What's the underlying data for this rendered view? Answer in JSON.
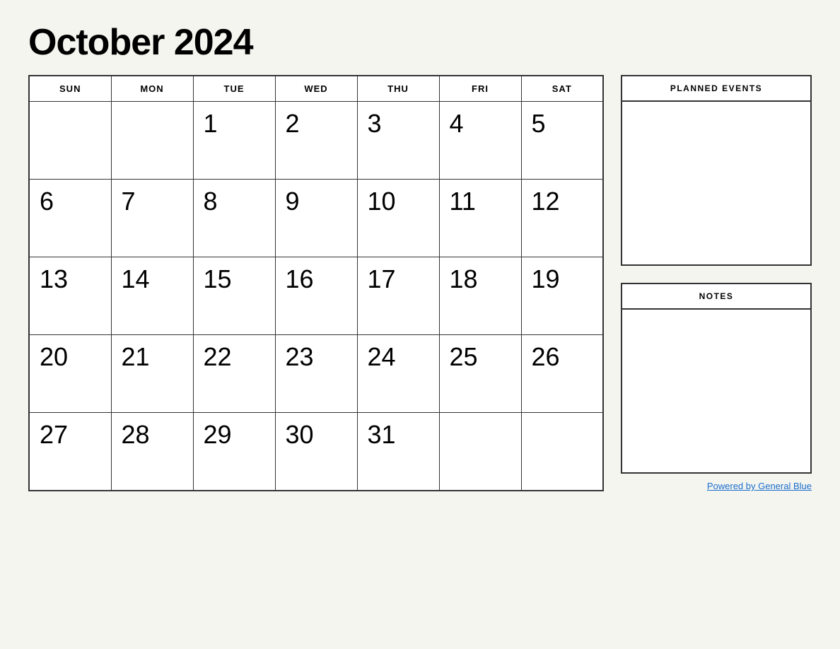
{
  "title": "October 2024",
  "days_of_week": [
    "SUN",
    "MON",
    "TUE",
    "WED",
    "THU",
    "FRI",
    "SAT"
  ],
  "weeks": [
    [
      "",
      "",
      "1",
      "2",
      "3",
      "4",
      "5"
    ],
    [
      "6",
      "7",
      "8",
      "9",
      "10",
      "11",
      "12"
    ],
    [
      "13",
      "14",
      "15",
      "16",
      "17",
      "18",
      "19"
    ],
    [
      "20",
      "21",
      "22",
      "23",
      "24",
      "25",
      "26"
    ],
    [
      "27",
      "28",
      "29",
      "30",
      "31",
      "",
      ""
    ]
  ],
  "sidebar": {
    "planned_events_label": "PLANNED EVENTS",
    "notes_label": "NOTES"
  },
  "footer": {
    "powered_by_text": "Powered by General Blue",
    "powered_by_url": "#"
  }
}
